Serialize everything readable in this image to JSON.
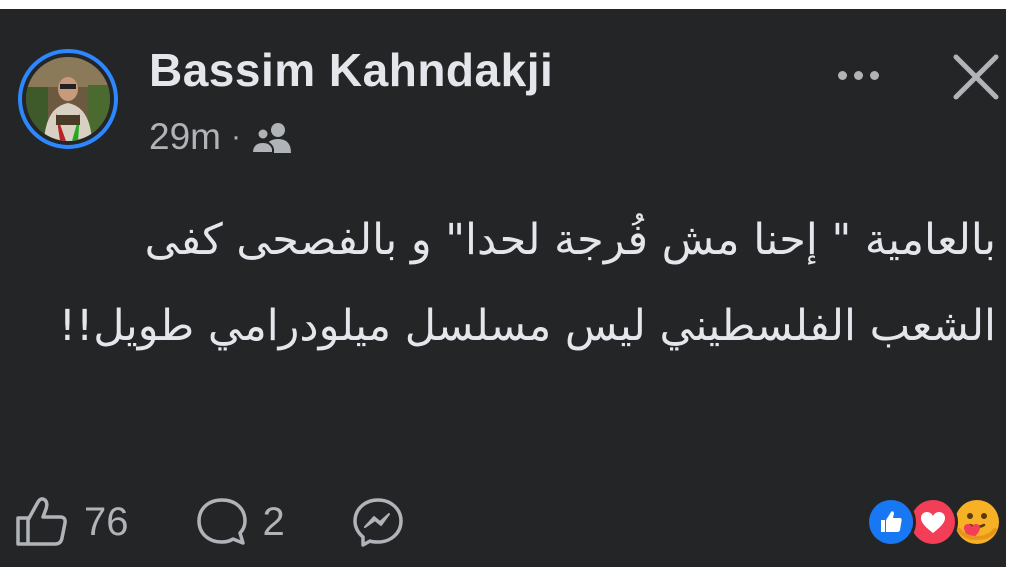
{
  "post": {
    "author": "Bassim Kahndakji",
    "time": "29m",
    "separator": "·",
    "audience_icon": "friends-icon",
    "text": "بالعامية \" إحنا مش فُرجة لحدا\" و بالفصحى كفى الشعب الفلسطيني ليس مسلسل ميلودرامي طويل!!"
  },
  "actions": {
    "like_count": "76",
    "comment_count": "2"
  },
  "reactions": [
    "like",
    "love",
    "care"
  ],
  "colors": {
    "card_bg": "#242526",
    "ring": "#2d88ff",
    "like": "#1877f2",
    "love": "#f33e58",
    "care": "#f7b125"
  }
}
